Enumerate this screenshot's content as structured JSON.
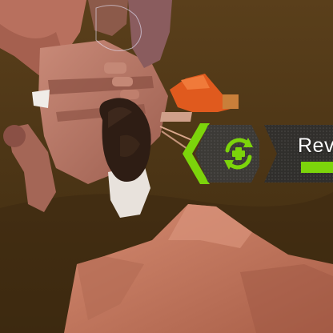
{
  "hud": {
    "revive_prompt": {
      "label": "Revi",
      "icon": "revive-icon",
      "progress": 1.0,
      "accent_color": "#7cd40b"
    }
  },
  "scene": {
    "background_color": "#4a3415",
    "rock_color": "#c2775f",
    "character_color": "#b87766"
  }
}
